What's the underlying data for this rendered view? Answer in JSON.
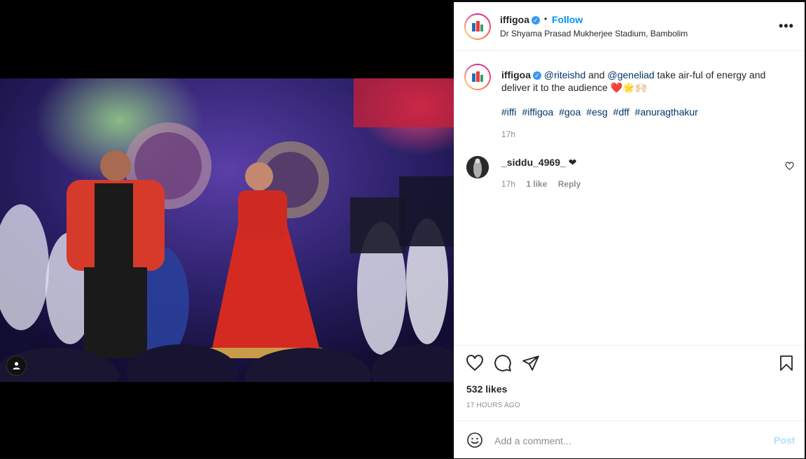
{
  "post": {
    "username": "iffigoa",
    "verified_mark": "✓",
    "dot": "•",
    "follow_label": "Follow",
    "location": "Dr Shyama Prasad Mukherjee Stadium, Bambolim",
    "more_label": "•••"
  },
  "caption": {
    "username": "iffigoa",
    "mention1": "@riteishd",
    "and_text": " and ",
    "mention2": "@geneliad",
    "text": " take air-ful of energy and deliver it to the audience ❤️🌟🙌🏻",
    "hashtags": [
      "#iffi",
      "#iffigoa",
      "#goa",
      "#esg",
      "#dff",
      "#anuragthakur"
    ],
    "time": "17h"
  },
  "comment": {
    "username": "_siddu_4969_",
    "text": " ❤",
    "time": "17h",
    "likes": "1 like",
    "reply": "Reply"
  },
  "actions": {
    "likes": "532 likes",
    "time_ago": "17 HOURS AGO"
  },
  "add_comment": {
    "placeholder": "Add a comment...",
    "post_label": "Post"
  },
  "icons": {
    "verified": "verified-badge-icon",
    "like": "heart-icon",
    "comment": "comment-bubble-icon",
    "share": "paper-plane-icon",
    "save": "bookmark-icon",
    "emoji": "smiley-icon",
    "tag": "user-tag-icon",
    "comment_like": "small-heart-icon"
  },
  "colors": {
    "link": "#00376b",
    "follow": "#0095f6",
    "post_disabled": "#b2dffc",
    "verified": "#3897f0"
  }
}
